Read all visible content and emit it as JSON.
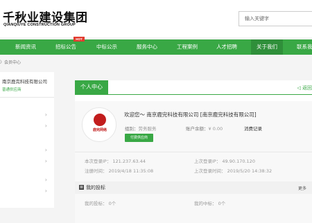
{
  "header": {
    "logo_title": "千秋业建设集团",
    "logo_subtitle": "QIANQIUYE CONSTRUCTION GROUP",
    "search_placeholder": "输入关键字"
  },
  "nav": {
    "items": [
      {
        "label": "首页"
      },
      {
        "label": "新闻资讯"
      },
      {
        "label": "招标公告",
        "badge": "HOT"
      },
      {
        "label": "中标公示"
      },
      {
        "label": "服务中心"
      },
      {
        "label": "工程案例"
      },
      {
        "label": "人才招聘"
      },
      {
        "label": "关于我们"
      },
      {
        "label": "联系我们"
      }
    ]
  },
  "breadcrumb": {
    "sep": "〉",
    "current": "会员中心"
  },
  "sidebar": {
    "company": "南京鹿完科技有限公司",
    "vip_label": "普通供应商",
    "rows": [
      "",
      "",
      "",
      "",
      "",
      ""
    ]
  },
  "main": {
    "tab_label": "个人中心",
    "back_link": "◁ 返回",
    "welcome": "欢迎您～ 南京鹿完科技有限公司 [南京鹿完科技有限公司]",
    "group_label": "组别：",
    "group_value": "劳务服务",
    "balance_label": "账户余额：",
    "balance_value": "¥ 0.00",
    "consume_label": "消费记录",
    "apply_button": "付费供应商",
    "avatar_text": "鹿完网络",
    "this_ip": "本次登录IP：  121.237.63.44",
    "last_ip": "上次登录IP：  49.90.170.120",
    "register_time": "注册时间：  2019/4/18 11:35:08",
    "last_login_time": "上次登录时间：  2019/5/20 14:38:32",
    "bids_section_title": "我的投标",
    "more": "更多",
    "my_bids": "我的投标：  0个",
    "my_wins": "我的中标：  0个"
  },
  "colors": {
    "accent": "#39a845",
    "hot": "#e23b2e"
  }
}
